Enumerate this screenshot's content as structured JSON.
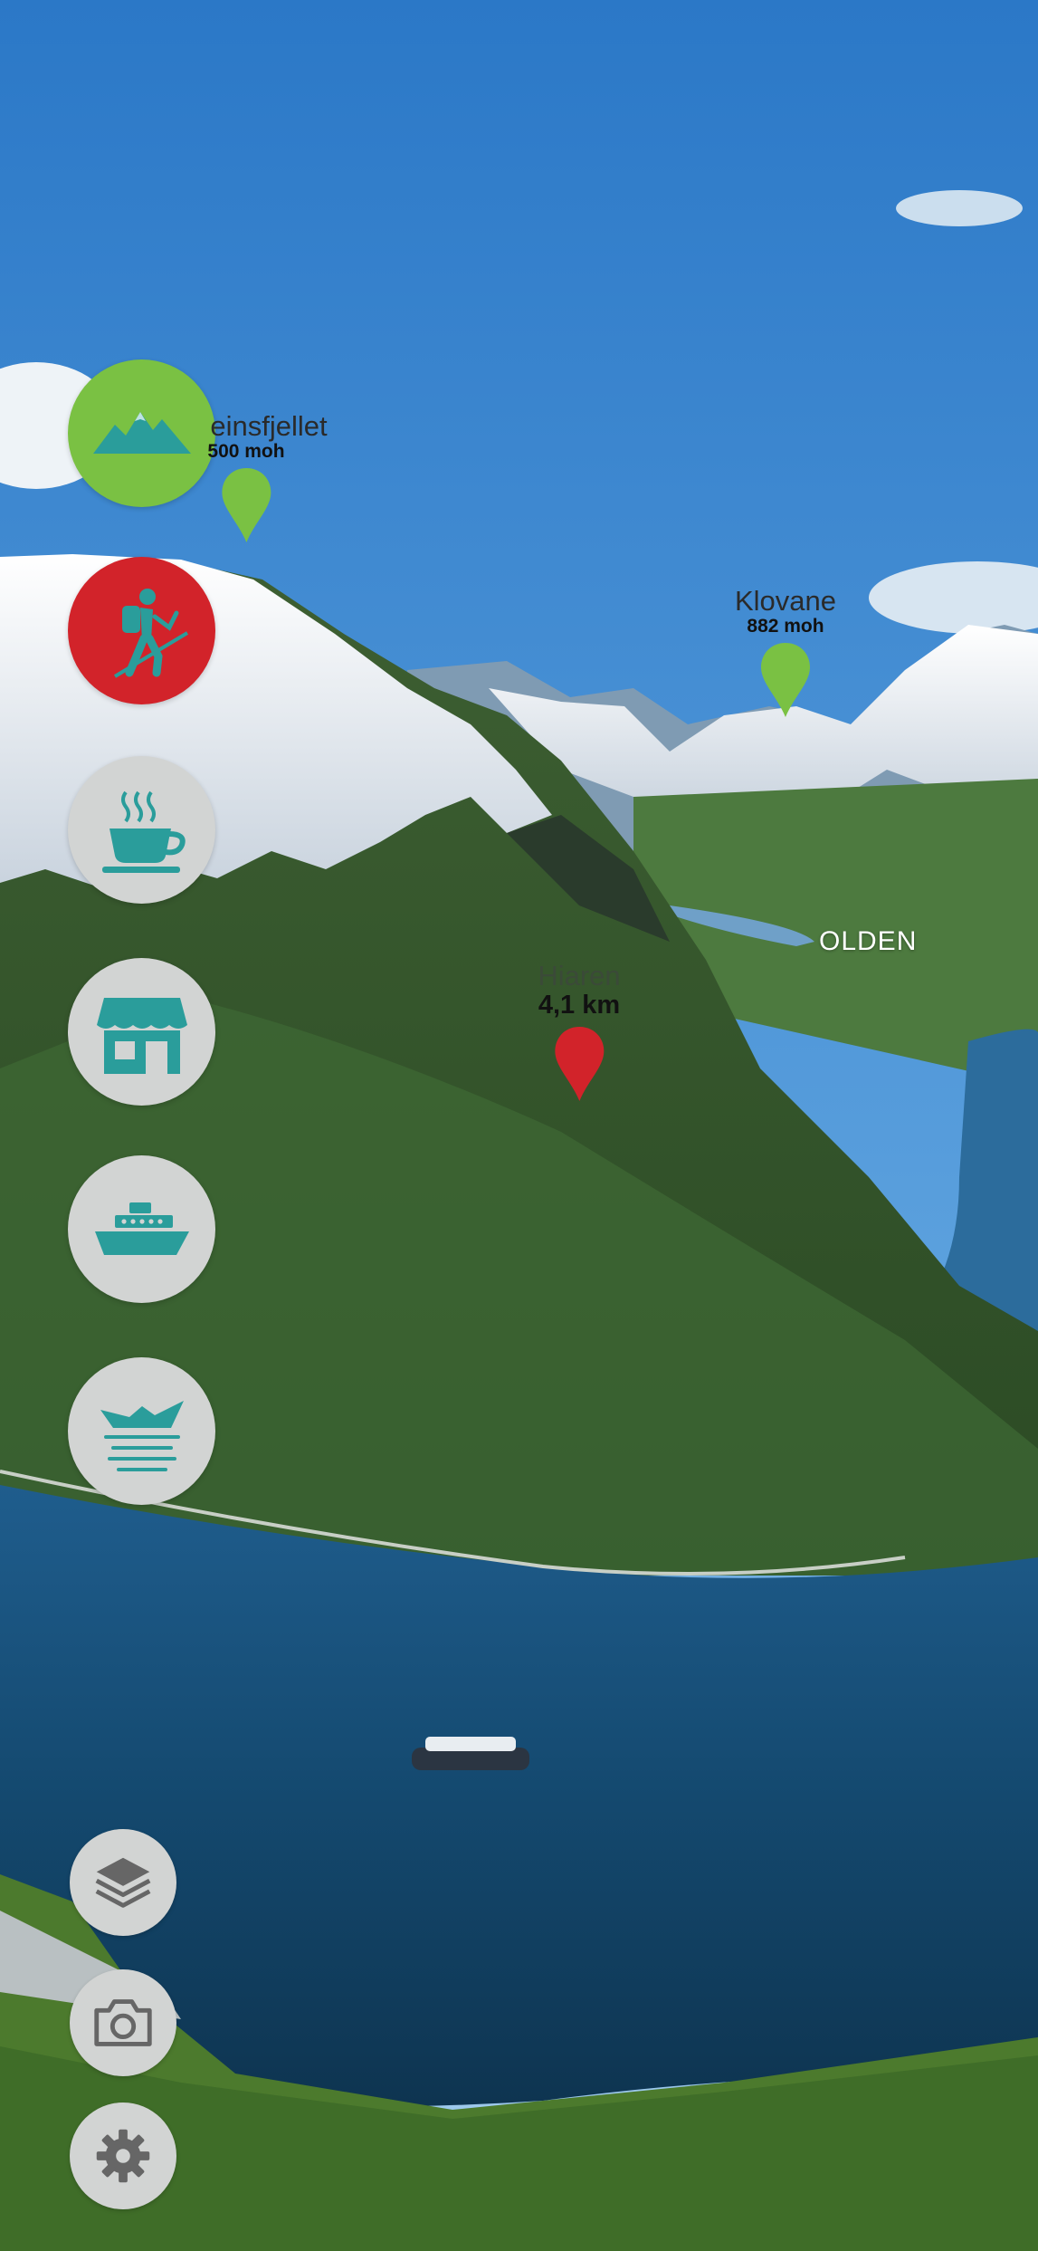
{
  "category_buttons": [
    {
      "name": "mountain-peaks",
      "icon": "mountains-icon",
      "state": "active",
      "color": "#7ac143"
    },
    {
      "name": "hiking",
      "icon": "hiker-icon",
      "state": "active",
      "color": "#d2232a"
    },
    {
      "name": "cafe",
      "icon": "coffee-cup-icon",
      "state": "inactive",
      "color": "#d2d4d3"
    },
    {
      "name": "shop",
      "icon": "storefront-icon",
      "state": "inactive",
      "color": "#d2d4d3"
    },
    {
      "name": "cruise",
      "icon": "cruise-ship-icon",
      "state": "inactive",
      "color": "#d2d4d3"
    },
    {
      "name": "fjord",
      "icon": "fjord-view-icon",
      "state": "inactive",
      "color": "#d2d4d3"
    }
  ],
  "tool_buttons": [
    {
      "name": "layers",
      "icon": "layers-icon"
    },
    {
      "name": "camera",
      "icon": "camera-icon"
    },
    {
      "name": "settings",
      "icon": "gear-icon"
    }
  ],
  "pois": {
    "peak1": {
      "name": "einsfjellet",
      "detail": "500 moh",
      "pin_color": "#7ac143"
    },
    "peak2": {
      "name": "Klovane",
      "detail": "882 moh",
      "pin_color": "#7ac143"
    },
    "trail": {
      "name": "Hiaren",
      "detail": "4,1 km",
      "pin_color": "#d2232a"
    }
  },
  "place_label": "OLDEN",
  "colors": {
    "icon_teal": "#2a9d9b",
    "pin_green": "#7ac143",
    "pin_red": "#d2232a"
  }
}
